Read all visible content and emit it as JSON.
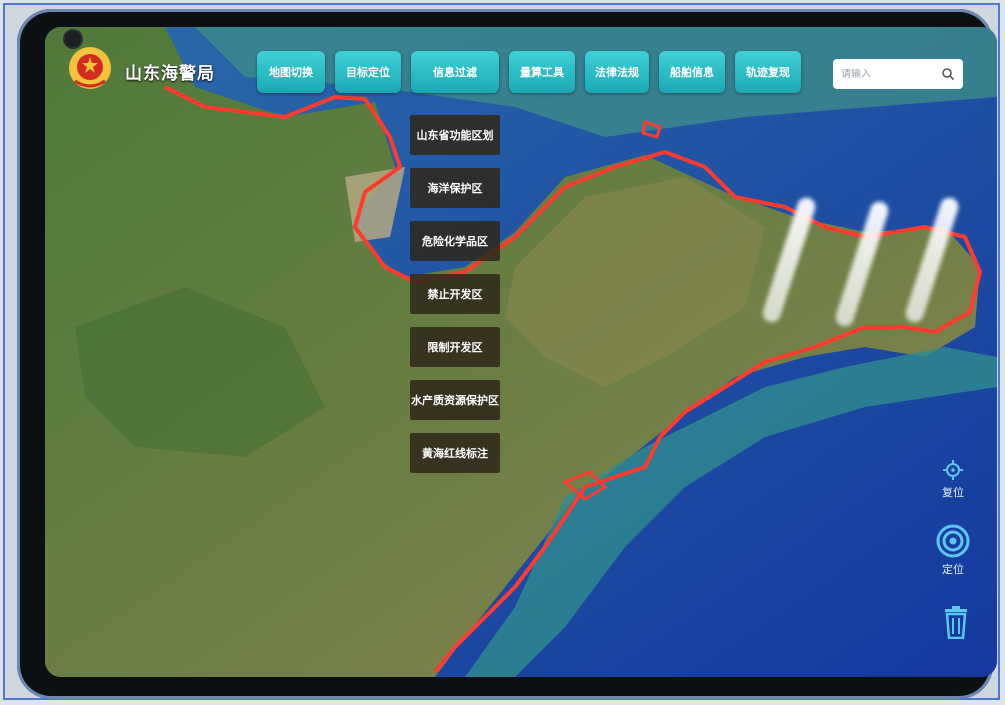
{
  "app": {
    "title": "山东海警局"
  },
  "tabs": [
    {
      "label": "地图切换"
    },
    {
      "label": "目标定位"
    },
    {
      "label": "信息过滤"
    },
    {
      "label": "量算工具"
    },
    {
      "label": "法律法规"
    },
    {
      "label": "船舶信息"
    },
    {
      "label": "轨迹复现"
    }
  ],
  "search": {
    "placeholder": "请输入",
    "icon": "search-icon"
  },
  "filter_menu": {
    "items": [
      {
        "label": "山东省功能区划"
      },
      {
        "label": "海洋保护区"
      },
      {
        "label": "危险化学品区"
      },
      {
        "label": "禁止开发区"
      },
      {
        "label": "限制开发区"
      },
      {
        "label": "水产质资源保护区"
      },
      {
        "label": "黄海红线标注"
      }
    ]
  },
  "side_tools": {
    "reset": {
      "label": "复位",
      "icon": "crosshair-icon"
    },
    "locate": {
      "label": "定位",
      "icon": "target-icon"
    },
    "clear": {
      "icon": "trash-icon"
    }
  },
  "colors": {
    "accent": "#24b8c2",
    "redline": "#ff3b30",
    "sea": "#1f4fa8",
    "land": "#5b7a3a"
  }
}
